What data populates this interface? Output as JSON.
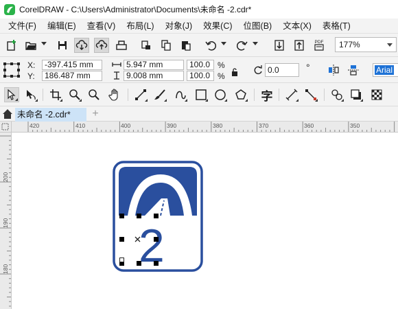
{
  "window": {
    "title": "CorelDRAW - C:\\Users\\Administrator\\Documents\\未命名 -2.cdr*"
  },
  "menu": [
    "文件(F)",
    "编辑(E)",
    "查看(V)",
    "布局(L)",
    "对象(J)",
    "效果(C)",
    "位图(B)",
    "文本(X)",
    "表格(T)"
  ],
  "toolbar": {
    "zoom": "177%",
    "pdf_label": "PDF"
  },
  "properties": {
    "x_label": "X:",
    "y_label": "Y:",
    "x_value": "-397.415 mm",
    "y_value": "186.487 mm",
    "width_value": "5.947 mm",
    "height_value": "9.008 mm",
    "scale_x": "100.0",
    "scale_y": "100.0",
    "percent_unit": "%",
    "rotation": "0.0",
    "degree_symbol": "°",
    "font_name": "Arial"
  },
  "toolbox": {
    "text_tool_glyph": "字"
  },
  "tabs": {
    "document": "未命名 -2.cdr*",
    "add_symbol": "+"
  },
  "rulers": {
    "horizontal": [
      "420",
      "410",
      "400",
      "390",
      "380",
      "370",
      "360",
      "350"
    ],
    "vertical": [
      "200",
      "190",
      "180"
    ]
  },
  "canvas": {
    "sign_number": "2"
  },
  "colors": {
    "sign_blue": "#2a4f9e",
    "tab_active": "#cde3f7",
    "selection_text": "#1e72d6",
    "logo_green": "#2bb34a"
  }
}
